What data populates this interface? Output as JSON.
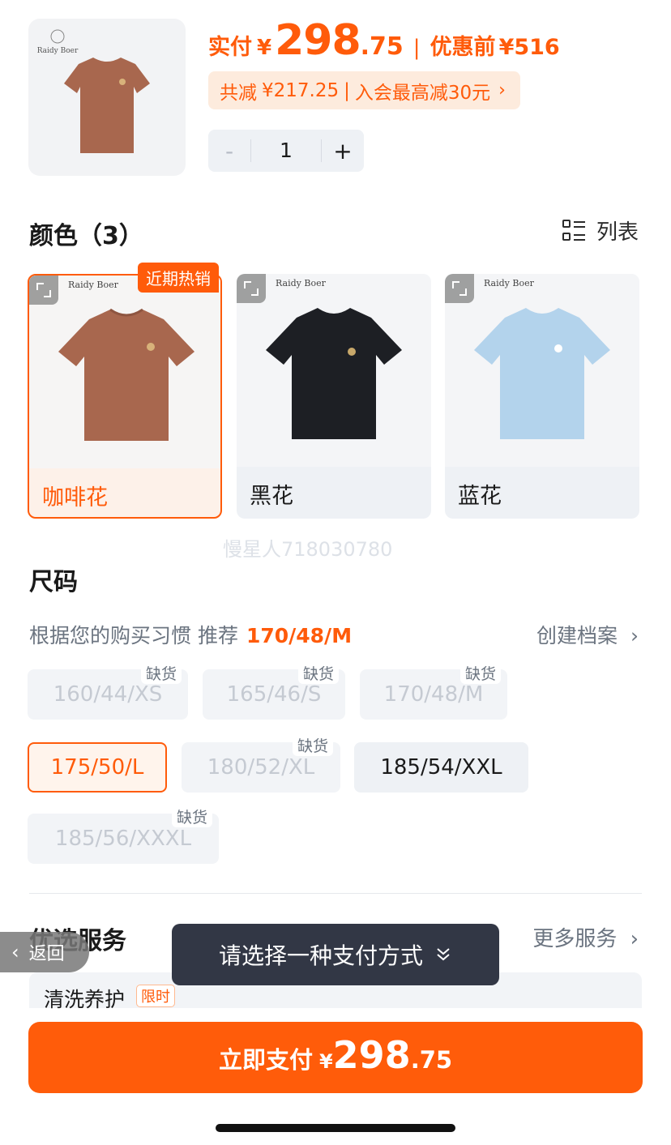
{
  "header": {
    "paid_label": "实付",
    "currency": "¥",
    "price_int": "298",
    "price_dec": ".75",
    "separator": "|",
    "original_label": "优惠前",
    "original_price": "¥516",
    "discount": {
      "total_label": "共减",
      "total_amount": "¥217.25",
      "separator": "|",
      "member_text": "入会最高减30元",
      "chevron": "›"
    },
    "quantity": {
      "minus": "-",
      "value": "1",
      "plus": "+"
    }
  },
  "color_section": {
    "title": "颜色（3）",
    "list_toggle": "列表",
    "hot_badge": "近期热销",
    "brand": "Raidy Boer",
    "items": [
      {
        "label": "咖啡花",
        "shirt_color": "#a8674e",
        "selected": true
      },
      {
        "label": "黑花",
        "shirt_color": "#1d1f24",
        "selected": false
      },
      {
        "label": "蓝花",
        "shirt_color": "#b3d3ec",
        "selected": false
      }
    ]
  },
  "watermark": "慢星人718030780",
  "size_section": {
    "title": "尺码",
    "recommend_text": "根据您的购买习惯 推荐",
    "recommend_size": "170/48/M",
    "create_profile": "创建档案",
    "out_of_stock": "缺货",
    "sizes": [
      {
        "label": "160/44/XS",
        "status": "out_of_stock"
      },
      {
        "label": "165/46/S",
        "status": "out_of_stock"
      },
      {
        "label": "170/48/M",
        "status": "out_of_stock"
      },
      {
        "label": "175/50/L",
        "status": "selected"
      },
      {
        "label": "180/52/XL",
        "status": "out_of_stock"
      },
      {
        "label": "185/54/XXL",
        "status": "available"
      },
      {
        "label": "185/56/XXXL",
        "status": "out_of_stock"
      }
    ]
  },
  "services": {
    "title": "优选服务",
    "more": "更多服务",
    "item_label": "清洗养护",
    "item_tag": "限时"
  },
  "back": "返回",
  "toast": "请选择一种支付方式",
  "pay_button": {
    "label": "立即支付",
    "currency": "¥",
    "price_int": "298",
    "price_dec": ".75"
  },
  "colors": {
    "accent": "#ff5b0a",
    "toast_bg": "#323745"
  }
}
